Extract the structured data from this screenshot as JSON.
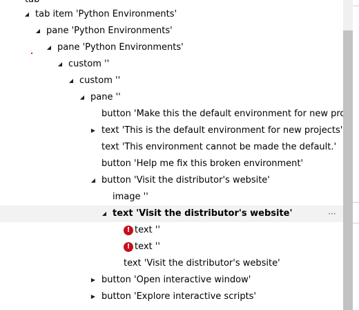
{
  "tree": {
    "rows": [
      {
        "label": "tab",
        "expander": ""
      },
      {
        "label": "tab item 'Python Environments'",
        "expander": "◢"
      },
      {
        "label": "pane 'Python Environments'",
        "expander": "◢"
      },
      {
        "label": "pane 'Python Environments'",
        "expander": "◢"
      },
      {
        "label": "custom ''",
        "expander": "◢"
      },
      {
        "label": "custom ''",
        "expander": "◢"
      },
      {
        "label": "pane ''",
        "expander": "◢"
      },
      {
        "label": "button 'Make this the default environment for new proje",
        "expander": ""
      },
      {
        "label": "text 'This is the default environment for new projects'",
        "expander": "▶"
      },
      {
        "label": "text 'This environment cannot be made the default.'",
        "expander": ""
      },
      {
        "label": "button 'Help me fix this broken environment'",
        "expander": ""
      },
      {
        "label": "button 'Visit the distributor's website'",
        "expander": "◢"
      },
      {
        "label": "image ''",
        "expander": ""
      },
      {
        "label": "text 'Visit the distributor's website'",
        "expander": "◢"
      },
      {
        "label": "text ''",
        "expander": "",
        "error_glyph": "!"
      },
      {
        "label": "text ''",
        "expander": "",
        "error_glyph": "!"
      },
      {
        "label": "text 'Visit the distributor's website'",
        "expander": ""
      },
      {
        "label": "button 'Open interactive window'",
        "expander": "▶"
      },
      {
        "label": "button 'Explore interactive scripts'",
        "expander": "▶"
      }
    ],
    "selected_row_actions": "···"
  },
  "colors": {
    "selected_row_bg": "#f2f2f2",
    "error_icon": "#c50f1f",
    "scrollbar_thumb": "#c2c2c2"
  }
}
